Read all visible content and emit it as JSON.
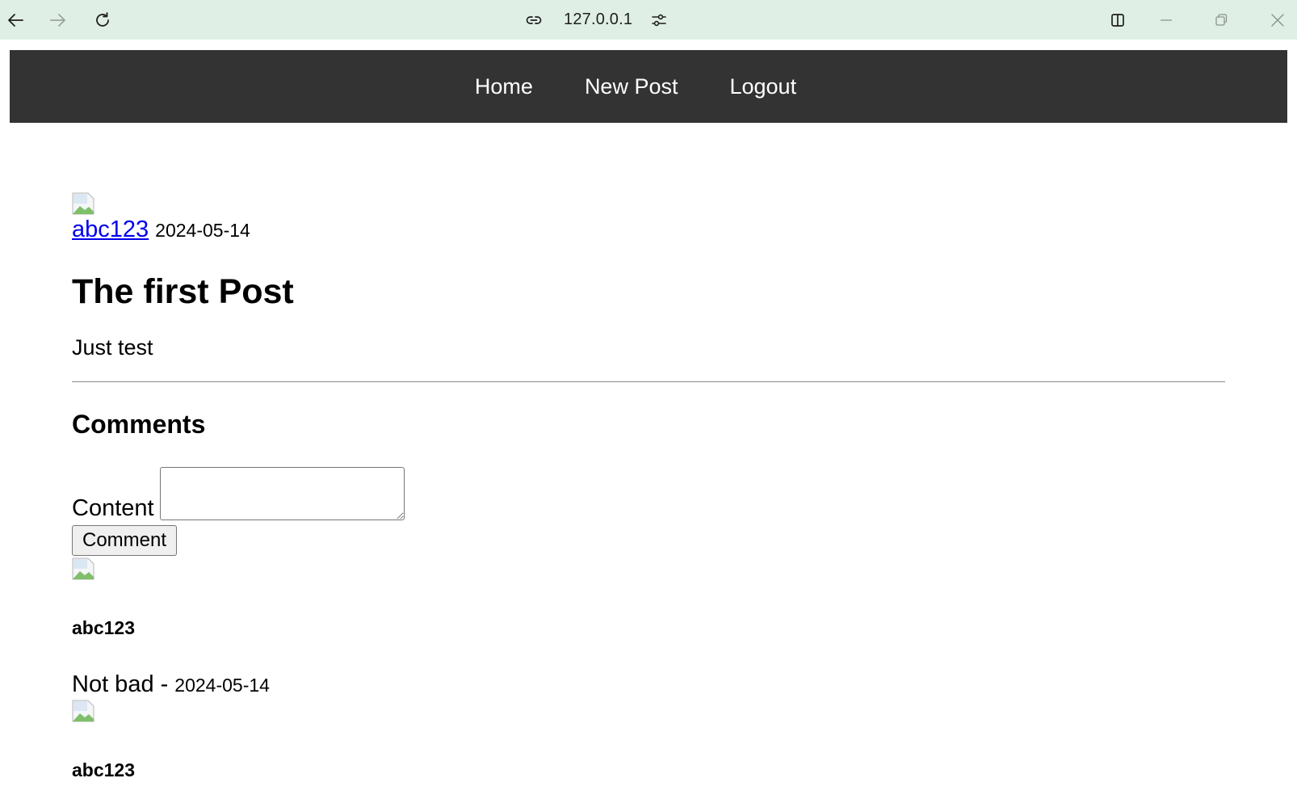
{
  "browser": {
    "address": "127.0.0.1",
    "icons": {
      "back": "arrow-left-icon",
      "forward": "arrow-right-icon",
      "reload": "reload-icon",
      "site_info": "link-icon",
      "tune": "tune-icon",
      "split": "split-view-icon",
      "minimize": "minimize-icon",
      "restore": "restore-icon",
      "close": "close-icon"
    }
  },
  "nav": {
    "items": [
      {
        "label": "Home"
      },
      {
        "label": "New Post"
      },
      {
        "label": "Logout"
      }
    ]
  },
  "post": {
    "author": "abc123",
    "date": "2024-05-14",
    "title": "The first Post",
    "body": "Just test"
  },
  "comments": {
    "heading": "Comments",
    "form": {
      "content_label": "Content",
      "content_value": "",
      "submit_label": "Comment"
    },
    "items": [
      {
        "author": "abc123",
        "text": "Not bad - ",
        "date": "2024-05-14"
      },
      {
        "author": "abc123"
      }
    ]
  },
  "colors": {
    "chrome_bg": "#e0efe5",
    "nav_bg": "#333333",
    "nav_text": "#ffffff",
    "link": "#0000ee"
  }
}
